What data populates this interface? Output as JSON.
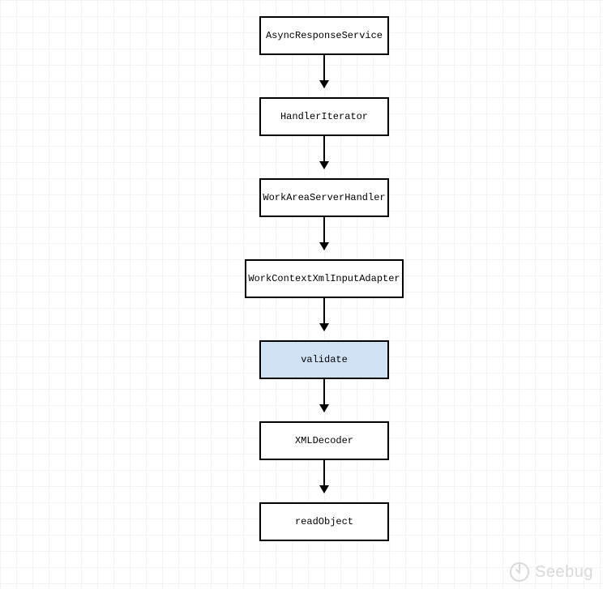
{
  "chart_data": {
    "type": "flowchart",
    "direction": "top-to-bottom",
    "nodes": [
      {
        "id": "n1",
        "label": "AsyncResponseService",
        "highlight": false
      },
      {
        "id": "n2",
        "label": "HandlerIterator",
        "highlight": false
      },
      {
        "id": "n3",
        "label": "WorkAreaServerHandler",
        "highlight": false
      },
      {
        "id": "n4",
        "label": "WorkContextXmlInputAdapter",
        "highlight": false
      },
      {
        "id": "n5",
        "label": "validate",
        "highlight": true
      },
      {
        "id": "n6",
        "label": "XMLDecoder",
        "highlight": false
      },
      {
        "id": "n7",
        "label": "readObject",
        "highlight": false
      }
    ],
    "edges": [
      [
        "n1",
        "n2"
      ],
      [
        "n2",
        "n3"
      ],
      [
        "n3",
        "n4"
      ],
      [
        "n4",
        "n5"
      ],
      [
        "n5",
        "n6"
      ],
      [
        "n6",
        "n7"
      ]
    ]
  },
  "watermark": {
    "text": "Seebug"
  }
}
